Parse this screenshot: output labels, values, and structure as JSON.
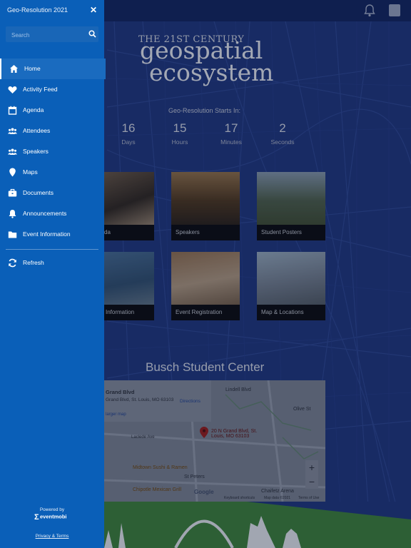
{
  "drawer": {
    "title": "Geo-Resolution 2021",
    "search_placeholder": "Search",
    "items": [
      {
        "label": "Home",
        "icon": "home-icon"
      },
      {
        "label": "Activity Feed",
        "icon": "heart-icon"
      },
      {
        "label": "Agenda",
        "icon": "calendar-icon"
      },
      {
        "label": "Attendees",
        "icon": "people-icon"
      },
      {
        "label": "Speakers",
        "icon": "people-icon"
      },
      {
        "label": "Maps",
        "icon": "map-pin-icon"
      },
      {
        "label": "Documents",
        "icon": "briefcase-icon"
      },
      {
        "label": "Announcements",
        "icon": "bell-icon"
      },
      {
        "label": "Event Information",
        "icon": "folder-icon"
      }
    ],
    "refresh_label": "Refresh",
    "powered_by": "Powered by",
    "brand": "eventmobi",
    "terms": "Privacy & Terms"
  },
  "hero": {
    "line1": "THE 21ST CENTURY",
    "line2": "geospatial",
    "line3": "ecosystem"
  },
  "countdown": {
    "label": "Geo-Resolution Starts In:",
    "units": [
      {
        "value": "16",
        "unit": "Days"
      },
      {
        "value": "15",
        "unit": "Hours"
      },
      {
        "value": "17",
        "unit": "Minutes"
      },
      {
        "value": "2",
        "unit": "Seconds"
      }
    ]
  },
  "tiles": [
    {
      "label": "da"
    },
    {
      "label": "Speakers"
    },
    {
      "label": "Student Posters"
    },
    {
      "label": "Information"
    },
    {
      "label": "Event Registration"
    },
    {
      "label": "Map & Locations"
    }
  ],
  "venue": {
    "title": "Busch Student Center",
    "map_header": "Grand Blvd",
    "map_address_line": "Grand Blvd, St. Louis, MO 63103",
    "directions": "Directions",
    "larger_map": "larger map",
    "pin_label": "20 N Grand Blvd, St. Louis, MO 63103",
    "poi1": "Midtown Sushi & Ramen",
    "poi2": "St Peters",
    "poi3": "Chipotle Mexican Grill",
    "poi4": "Chaifetz Arena",
    "street1": "Lindell Blvd",
    "street2": "Olive St",
    "street3": "Laclede Ave",
    "keyboard": "Keyboard shortcuts",
    "mapdata": "Map data ©2021",
    "terms": "Terms of Use",
    "google": "Google"
  },
  "colors": {
    "drawer": "#0a5fb8",
    "background": "#1f3479",
    "accent": "#ffffff"
  }
}
